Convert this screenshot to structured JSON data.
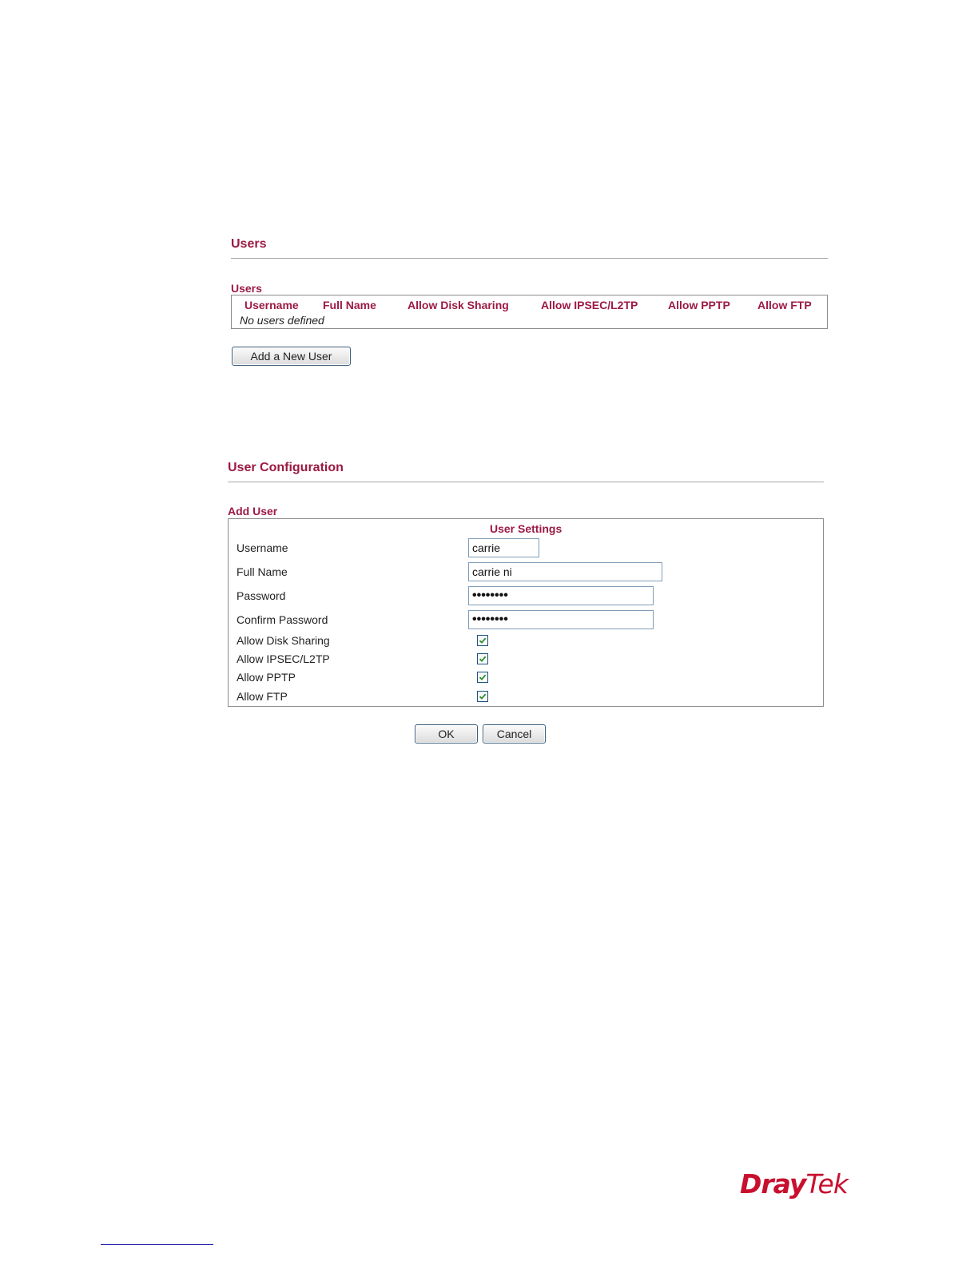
{
  "users_section": {
    "title": "Users",
    "table_title": "Users",
    "columns": [
      "Username",
      "Full Name",
      "Allow Disk Sharing",
      "Allow IPSEC/L2TP",
      "Allow PPTP",
      "Allow FTP"
    ],
    "empty_text": "No users defined",
    "add_button": "Add a New User"
  },
  "config_section": {
    "title": "User Configuration",
    "box_title": "Add User",
    "settings_header": "User Settings",
    "fields": {
      "username": {
        "label": "Username",
        "value": "carrie"
      },
      "full_name": {
        "label": "Full Name",
        "value": "carrie ni"
      },
      "password": {
        "label": "Password",
        "value": "••••••••"
      },
      "confirm_password": {
        "label": "Confirm Password",
        "value": "••••••••"
      }
    },
    "checkboxes": [
      {
        "label": "Allow Disk Sharing",
        "checked": true
      },
      {
        "label": "Allow IPSEC/L2TP",
        "checked": true
      },
      {
        "label": "Allow PPTP",
        "checked": true
      },
      {
        "label": "Allow FTP",
        "checked": true
      }
    ],
    "ok_button": "OK",
    "cancel_button": "Cancel"
  },
  "brand": {
    "logo_part1": "Dray",
    "logo_part2": "Tek",
    "color": "#c8102e"
  },
  "colors": {
    "accent": "#9c1a43",
    "checkmark": "#2e8b2e"
  }
}
